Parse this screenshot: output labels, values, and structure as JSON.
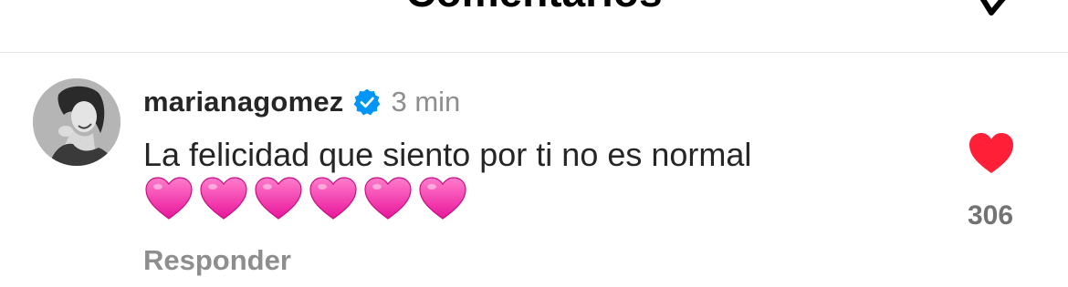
{
  "header": {
    "title": "Comentarios",
    "action_icon": "chevron-down-icon"
  },
  "comment": {
    "username": "marianagomez",
    "verified_icon": "verified-badge-icon",
    "timestamp": "3 min",
    "text": "La felicidad que siento por ti no es normal",
    "emojis": [
      "pink-heart",
      "pink-heart",
      "pink-heart",
      "pink-heart",
      "pink-heart",
      "pink-heart"
    ],
    "reply_label": "Responder",
    "like_icon": "heart-filled-icon",
    "like_count": "306"
  },
  "colors": {
    "text_primary": "#262626",
    "text_secondary": "#8e8e8e",
    "verified_blue": "#0095f6",
    "like_red": "#ff3040",
    "emoji_pink": "#ff3fb3"
  }
}
